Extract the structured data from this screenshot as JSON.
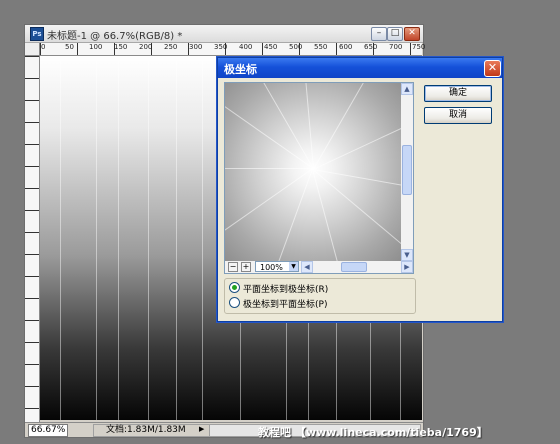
{
  "photoshop": {
    "logo_text": "Ps",
    "title": "未标题-1 @ 66.7%(RGB/8) *",
    "minimize": "–",
    "maximize": "□",
    "close": "✕",
    "ruler_h_labels": [
      "0",
      "50",
      "100",
      "150",
      "200",
      "250",
      "300",
      "350",
      "400",
      "450",
      "500",
      "550",
      "600",
      "650",
      "700",
      "750"
    ],
    "status": {
      "zoom": "66.67%",
      "doc": "文档:1.83M/1.83M",
      "arrow": "▶"
    }
  },
  "dialog": {
    "title": "极坐标",
    "close": "✕",
    "ok": "确定",
    "cancel": "取消",
    "zoom_value": "100%",
    "zoom_minus": "−",
    "zoom_plus": "+",
    "options": [
      {
        "label": "平面坐标到极坐标(R)",
        "selected": true
      },
      {
        "label": "极坐标到平面坐标(P)",
        "selected": false
      }
    ],
    "scroll_up": "▲",
    "scroll_down": "▼",
    "scroll_left": "◀",
    "scroll_right": "▶",
    "dropdown_arrow": "▼"
  },
  "watermark": "教程吧 【www.lineca.com/tieba/1769】",
  "colors": {
    "xp_title": "#1551d9",
    "radio_dot": "#21a121"
  }
}
